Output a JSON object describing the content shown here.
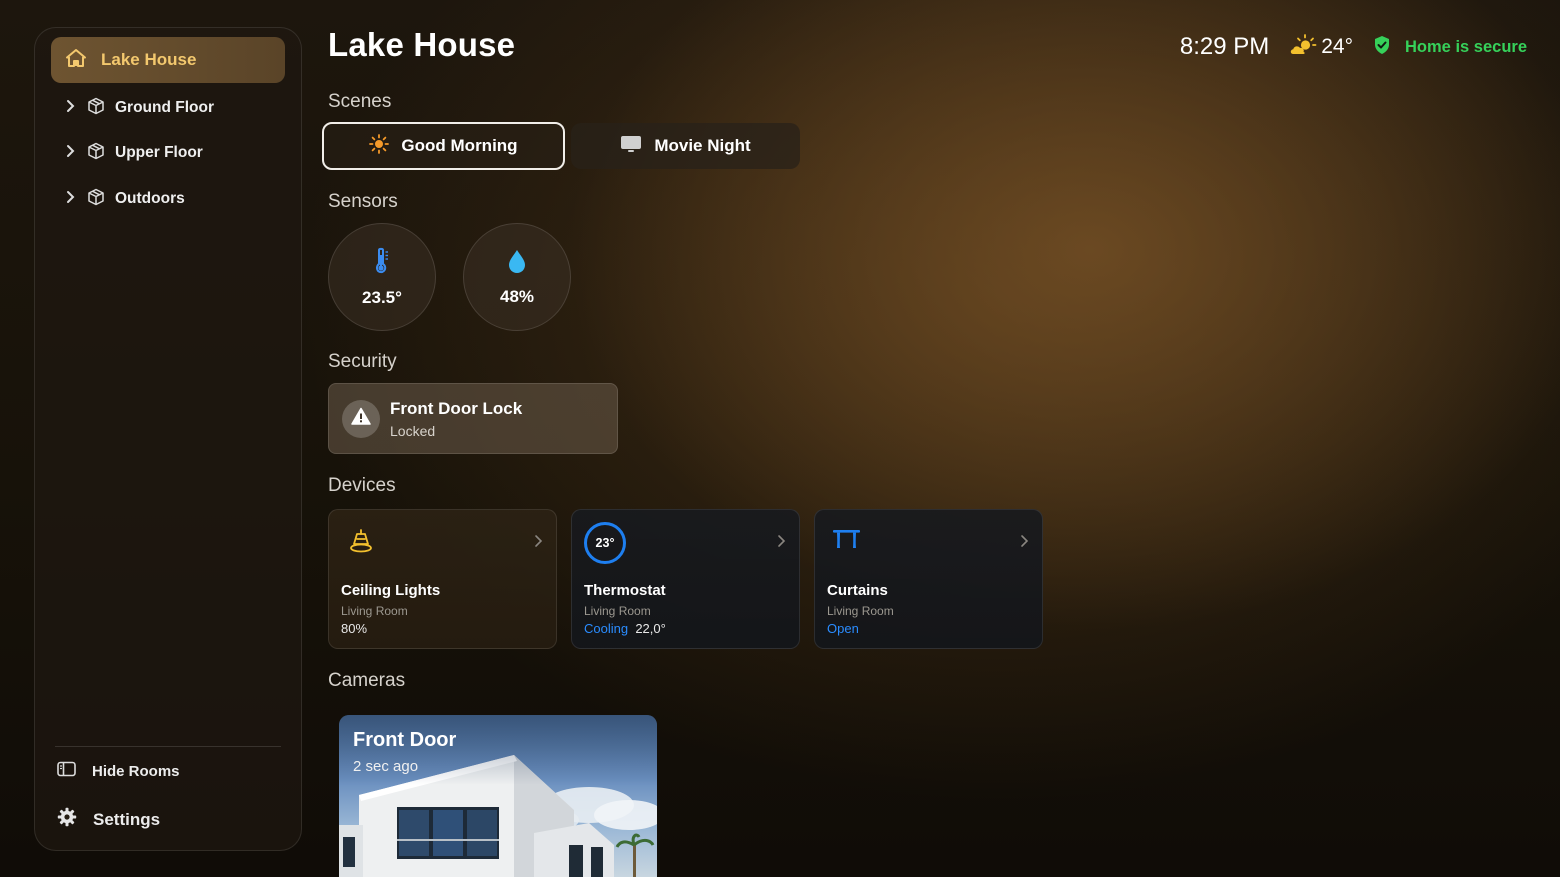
{
  "sidebar": {
    "home": {
      "label": "Lake House",
      "icon": "house-icon"
    },
    "floors": [
      {
        "label": "Ground Floor",
        "icon": "cube-icon"
      },
      {
        "label": "Upper Floor",
        "icon": "cube-icon"
      },
      {
        "label": "Outdoors",
        "icon": "cube-icon"
      }
    ],
    "hide_rooms": "Hide Rooms",
    "settings": "Settings"
  },
  "header": {
    "title": "Lake House",
    "time": "8:29 PM",
    "weather_temp": "24°",
    "security_status": "Home is secure"
  },
  "sections": {
    "scenes": "Scenes",
    "sensors": "Sensors",
    "security": "Security",
    "devices": "Devices",
    "cameras": "Cameras"
  },
  "scenes": [
    {
      "label": "Good Morning",
      "icon": "sun-icon",
      "active": true
    },
    {
      "label": "Movie Night",
      "icon": "tv-icon",
      "active": false
    }
  ],
  "sensors": [
    {
      "value": "23.5°",
      "icon": "thermometer-icon"
    },
    {
      "value": "48%",
      "icon": "droplet-icon"
    }
  ],
  "security": {
    "title": "Front Door Lock",
    "status": "Locked",
    "icon": "warning-icon"
  },
  "devices": [
    {
      "name": "Ceiling Lights",
      "room": "Living Room",
      "state": "80%",
      "icon": "ceiling-light-icon"
    },
    {
      "name": "Thermostat",
      "room": "Living Room",
      "state_label": "Cooling",
      "state_value": "22,0°",
      "ring_value": "23°"
    },
    {
      "name": "Curtains",
      "room": "Living Room",
      "state_label": "Open",
      "icon": "curtains-icon"
    }
  ],
  "cameras": [
    {
      "title": "Front Door",
      "time": "2 sec ago"
    }
  ],
  "colors": {
    "accent_gold": "#f3c86e",
    "secure_green": "#36d15a",
    "blue": "#2a8cff"
  }
}
